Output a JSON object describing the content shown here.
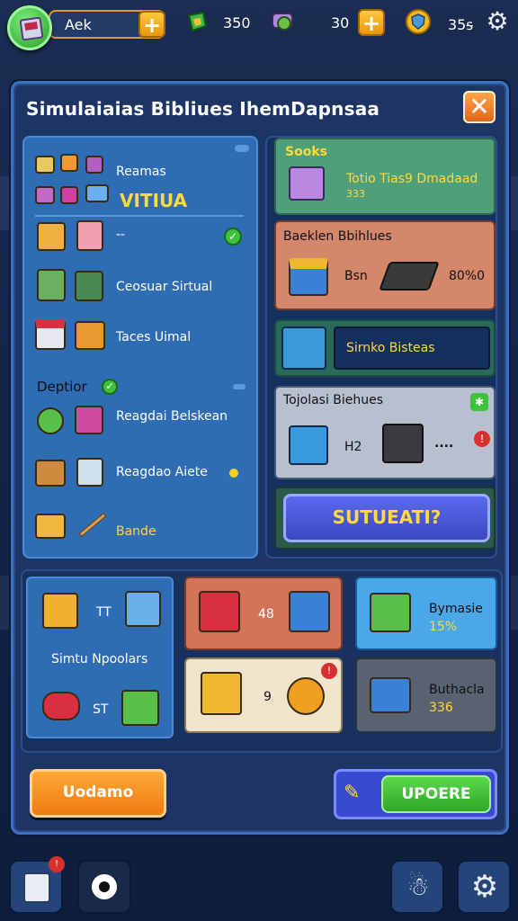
{
  "header": {
    "player_name": "Aek",
    "add_label": "+",
    "res1_value": "350",
    "res2_value": "30",
    "res3_value": "35ꟊ"
  },
  "panel": {
    "title": "Simulaiaias Bibliues IhemDapnsaa",
    "close_label": "✕"
  },
  "left_list": {
    "item1": "Reamas",
    "heading": "VITIUA",
    "item2": "--",
    "item3": "Ceosuar Sirtual",
    "item4": "Taces Uimal",
    "section2": "Deptior",
    "item5": "Reagdai Belskean",
    "item6": "Reagdao Aiete",
    "item7": "Bande"
  },
  "right_cards": {
    "card1_title": "Sooks",
    "card1_text": "Totio Tias9 Dmadaad",
    "card1_sub": "333",
    "card2_title": "Baeklen Bbihlues",
    "card2_mid": "Bsn",
    "card2_val": "80%0",
    "card3_label": "Sirnko Bisteas",
    "card4_title": "Tojolasi Biehues",
    "card4_mid": "H2",
    "card4_dots": "....",
    "action_label": "SUTUEATI?"
  },
  "bottom": {
    "left_val1": "TT",
    "left_label": "Simtu Npoolars",
    "left_val2": "ST",
    "red_val": "48",
    "cream_val": "9",
    "blue_title": "Bymasie",
    "blue_val": "15%",
    "gray_title": "Buthacla",
    "gray_val": "336"
  },
  "buttons": {
    "left_label": "Uodamo",
    "right_label": "UPOERE"
  },
  "colors": {
    "accent_orange": "#f59a1e",
    "accent_green": "#3ec23a",
    "accent_blue": "#4a5ad8",
    "panel_blue": "#2e6cb4"
  }
}
